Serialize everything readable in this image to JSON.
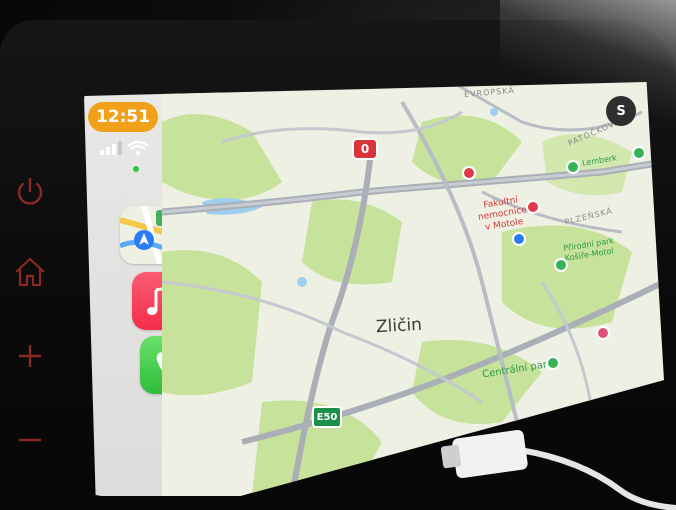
{
  "status_bar": {
    "time": "12:51",
    "signal_icon": "signal-bars-icon",
    "wifi_icon": "wifi-icon"
  },
  "dock": {
    "apps": [
      {
        "name": "Maps",
        "icon": "maps-icon"
      },
      {
        "name": "Music",
        "icon": "music-note-icon"
      },
      {
        "name": "Phone",
        "icon": "phone-handset-icon"
      }
    ],
    "app_grid_icon": "app-grid-icon"
  },
  "map": {
    "area_label": "Zličin",
    "hospital_label_line1": "Fakultní",
    "hospital_label_line2": "nemocnice",
    "hospital_label_line3": "v Motole",
    "park_label": "Centrální park",
    "nature_park_line1": "Přírodní park",
    "nature_park_line2": "Košíře-Motol",
    "poi_label_top": "Lemberk",
    "road_evrop": "EVROPSKÁ",
    "road_patock": "PATOČKOVA",
    "road_plzenska": "PLZEŇSKÁ",
    "route_badge": "0",
    "highway_badge": "E50",
    "account_initial": "S"
  },
  "hardware_buttons": [
    "power-icon",
    "home-icon",
    "volume-up-icon",
    "volume-down-icon"
  ],
  "colors": {
    "clock_pill": "#f0a019",
    "map_park": "#bfdf8f",
    "map_land": "#eef0e4",
    "road": "#a9aeb7",
    "accent_green": "#36b356",
    "accent_red": "#e0394a"
  }
}
